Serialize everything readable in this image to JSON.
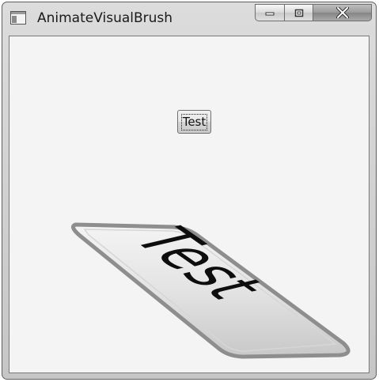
{
  "window": {
    "title": "AnimateVisualBrush",
    "icon": "app-window-icon",
    "controls": {
      "minimize_icon": "minimize-icon",
      "maximize_icon": "maximize-icon",
      "close_icon": "close-icon"
    }
  },
  "content": {
    "button_label": "Test",
    "brush_text": "Test"
  }
}
